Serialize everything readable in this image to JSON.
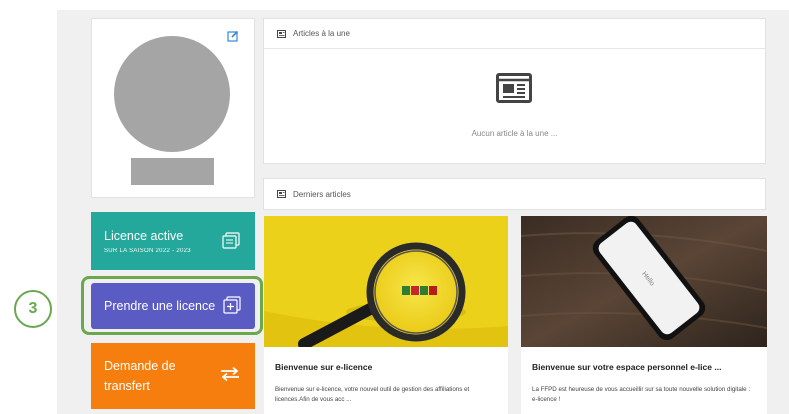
{
  "profile": {
    "edit_icon": "edit-icon",
    "avatar_color": "#a5a5a5"
  },
  "actions": {
    "licence_active": {
      "title": "Licence active",
      "subtitle": "SUR LA SAISON 2022 - 2023",
      "icon": "card-stack-icon",
      "color": "#24a89b"
    },
    "prendre_licence": {
      "title": "Prendre une licence",
      "icon": "card-add-icon",
      "color": "#5b5bc4"
    },
    "demande_transfert": {
      "title": "Demande de transfert",
      "icon": "transfer-arrows-icon",
      "color": "#f57e0f"
    }
  },
  "step_badge": {
    "number": "3",
    "color": "#6aa84f"
  },
  "featured": {
    "heading": "Articles à la une",
    "empty_message": "Aucun article à la une ..."
  },
  "latest": {
    "heading": "Derniers articles",
    "articles": [
      {
        "title": "Bienvenue sur e-licence",
        "excerpt": "Bienvenue sur e-licence, votre nouvel outil de gestion des affiliations et licences.Afin de vous acc ...",
        "image": "magnifying-glass-yellow"
      },
      {
        "title": "Bienvenue sur votre espace personnel e-lice ...",
        "excerpt": "La FFPD est heureuse de vous accueillir sur sa toute nouvelle solution digitale : e-licence !",
        "image": "phone-on-wood",
        "phone_text": "Hello"
      }
    ]
  }
}
